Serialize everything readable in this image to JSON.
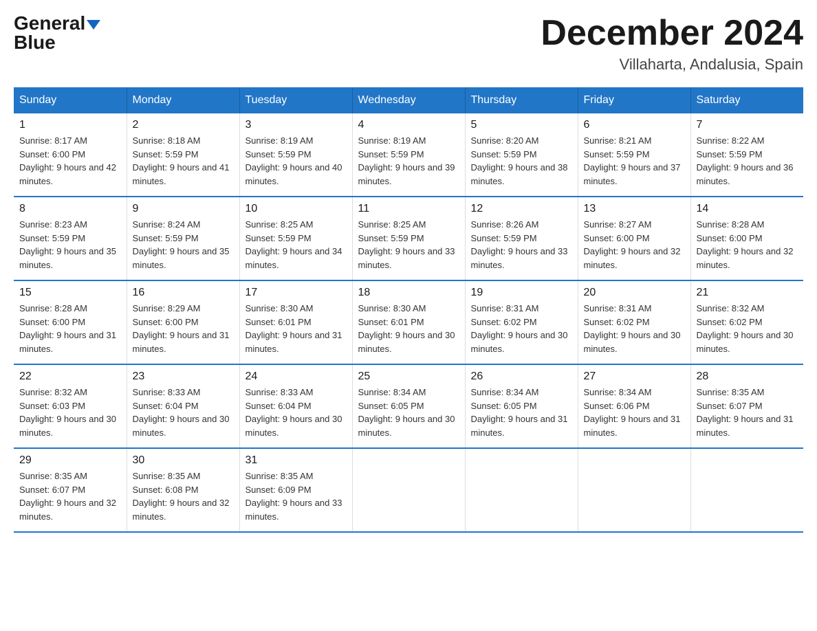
{
  "header": {
    "logo_general": "General",
    "logo_blue": "Blue",
    "month_title": "December 2024",
    "location": "Villaharta, Andalusia, Spain"
  },
  "days_of_week": [
    "Sunday",
    "Monday",
    "Tuesday",
    "Wednesday",
    "Thursday",
    "Friday",
    "Saturday"
  ],
  "weeks": [
    [
      {
        "day": "1",
        "sunrise": "8:17 AM",
        "sunset": "6:00 PM",
        "daylight": "9 hours and 42 minutes."
      },
      {
        "day": "2",
        "sunrise": "8:18 AM",
        "sunset": "5:59 PM",
        "daylight": "9 hours and 41 minutes."
      },
      {
        "day": "3",
        "sunrise": "8:19 AM",
        "sunset": "5:59 PM",
        "daylight": "9 hours and 40 minutes."
      },
      {
        "day": "4",
        "sunrise": "8:19 AM",
        "sunset": "5:59 PM",
        "daylight": "9 hours and 39 minutes."
      },
      {
        "day": "5",
        "sunrise": "8:20 AM",
        "sunset": "5:59 PM",
        "daylight": "9 hours and 38 minutes."
      },
      {
        "day": "6",
        "sunrise": "8:21 AM",
        "sunset": "5:59 PM",
        "daylight": "9 hours and 37 minutes."
      },
      {
        "day": "7",
        "sunrise": "8:22 AM",
        "sunset": "5:59 PM",
        "daylight": "9 hours and 36 minutes."
      }
    ],
    [
      {
        "day": "8",
        "sunrise": "8:23 AM",
        "sunset": "5:59 PM",
        "daylight": "9 hours and 35 minutes."
      },
      {
        "day": "9",
        "sunrise": "8:24 AM",
        "sunset": "5:59 PM",
        "daylight": "9 hours and 35 minutes."
      },
      {
        "day": "10",
        "sunrise": "8:25 AM",
        "sunset": "5:59 PM",
        "daylight": "9 hours and 34 minutes."
      },
      {
        "day": "11",
        "sunrise": "8:25 AM",
        "sunset": "5:59 PM",
        "daylight": "9 hours and 33 minutes."
      },
      {
        "day": "12",
        "sunrise": "8:26 AM",
        "sunset": "5:59 PM",
        "daylight": "9 hours and 33 minutes."
      },
      {
        "day": "13",
        "sunrise": "8:27 AM",
        "sunset": "6:00 PM",
        "daylight": "9 hours and 32 minutes."
      },
      {
        "day": "14",
        "sunrise": "8:28 AM",
        "sunset": "6:00 PM",
        "daylight": "9 hours and 32 minutes."
      }
    ],
    [
      {
        "day": "15",
        "sunrise": "8:28 AM",
        "sunset": "6:00 PM",
        "daylight": "9 hours and 31 minutes."
      },
      {
        "day": "16",
        "sunrise": "8:29 AM",
        "sunset": "6:00 PM",
        "daylight": "9 hours and 31 minutes."
      },
      {
        "day": "17",
        "sunrise": "8:30 AM",
        "sunset": "6:01 PM",
        "daylight": "9 hours and 31 minutes."
      },
      {
        "day": "18",
        "sunrise": "8:30 AM",
        "sunset": "6:01 PM",
        "daylight": "9 hours and 30 minutes."
      },
      {
        "day": "19",
        "sunrise": "8:31 AM",
        "sunset": "6:02 PM",
        "daylight": "9 hours and 30 minutes."
      },
      {
        "day": "20",
        "sunrise": "8:31 AM",
        "sunset": "6:02 PM",
        "daylight": "9 hours and 30 minutes."
      },
      {
        "day": "21",
        "sunrise": "8:32 AM",
        "sunset": "6:02 PM",
        "daylight": "9 hours and 30 minutes."
      }
    ],
    [
      {
        "day": "22",
        "sunrise": "8:32 AM",
        "sunset": "6:03 PM",
        "daylight": "9 hours and 30 minutes."
      },
      {
        "day": "23",
        "sunrise": "8:33 AM",
        "sunset": "6:04 PM",
        "daylight": "9 hours and 30 minutes."
      },
      {
        "day": "24",
        "sunrise": "8:33 AM",
        "sunset": "6:04 PM",
        "daylight": "9 hours and 30 minutes."
      },
      {
        "day": "25",
        "sunrise": "8:34 AM",
        "sunset": "6:05 PM",
        "daylight": "9 hours and 30 minutes."
      },
      {
        "day": "26",
        "sunrise": "8:34 AM",
        "sunset": "6:05 PM",
        "daylight": "9 hours and 31 minutes."
      },
      {
        "day": "27",
        "sunrise": "8:34 AM",
        "sunset": "6:06 PM",
        "daylight": "9 hours and 31 minutes."
      },
      {
        "day": "28",
        "sunrise": "8:35 AM",
        "sunset": "6:07 PM",
        "daylight": "9 hours and 31 minutes."
      }
    ],
    [
      {
        "day": "29",
        "sunrise": "8:35 AM",
        "sunset": "6:07 PM",
        "daylight": "9 hours and 32 minutes."
      },
      {
        "day": "30",
        "sunrise": "8:35 AM",
        "sunset": "6:08 PM",
        "daylight": "9 hours and 32 minutes."
      },
      {
        "day": "31",
        "sunrise": "8:35 AM",
        "sunset": "6:09 PM",
        "daylight": "9 hours and 33 minutes."
      },
      null,
      null,
      null,
      null
    ]
  ]
}
